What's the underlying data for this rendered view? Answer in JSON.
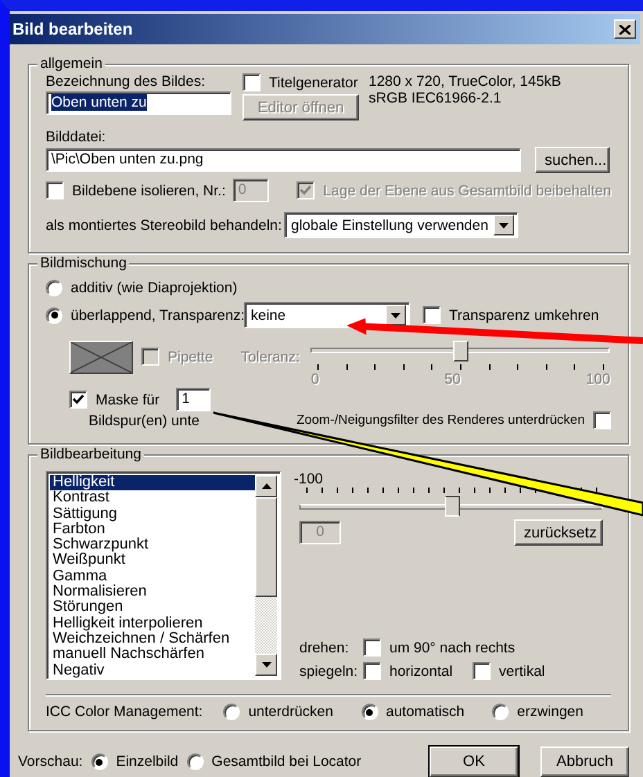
{
  "window": {
    "title": "Bild bearbeiten"
  },
  "allgemein": {
    "legend": "allgemein",
    "name_label": "Bezeichnung des Bildes:",
    "name_value": "Oben unten zu",
    "title_generator": {
      "label": "Titelgenerator",
      "checked": false
    },
    "editor_button": {
      "label": "Editor öffnen",
      "disabled": true
    },
    "image_info": [
      "1280 x 720, TrueColor, 145kB",
      "sRGB IEC61966-2.1"
    ],
    "file_label": "Bilddatei:",
    "file_value": "\\Pic\\Oben unten zu.png",
    "browse_button": "suchen...",
    "isolate": {
      "label": "Bildebene isolieren, Nr.:",
      "checked": false
    },
    "layer_number": {
      "value": "0",
      "disabled": true
    },
    "keep_position": {
      "label": "Lage der Ebene aus Gesamtbild beibehalten",
      "checked": true,
      "disabled": true
    },
    "stereo_label": "als montiertes Stereobild behandeln:",
    "stereo_value": "globale Einstellung verwenden"
  },
  "bildmischung": {
    "legend": "Bildmischung",
    "modes": [
      {
        "label": "additiv (wie Diaprojektion)",
        "selected": false
      },
      {
        "label": "überlappend, Transparenz:",
        "selected": true
      }
    ],
    "transparency": "keine",
    "invert": {
      "label": "Transparenz umkehren",
      "checked": false
    },
    "pipette": {
      "label": "Pipette",
      "checked": false,
      "disabled": true
    },
    "tolerance": {
      "label": "Toleranz:",
      "disabled": true,
      "level": 0.5,
      "ticks": [
        "0",
        "50",
        "100"
      ]
    },
    "mask": {
      "label": "Maske für",
      "checked": true,
      "value": "1"
    },
    "mask_suffix": "Bildspur(en) unte",
    "zoom_filter": {
      "label": "Zoom-/Neigungsfilter des Renderes unterdrücken",
      "checked": false
    }
  },
  "bildbearbeitung": {
    "legend": "Bildbearbeitung",
    "adjustments": [
      {
        "label": "Helligkeit",
        "selected": true
      },
      {
        "label": "Kontrast",
        "selected": false
      },
      {
        "label": "Sättigung",
        "selected": false
      },
      {
        "label": "Farbton",
        "selected": false
      },
      {
        "label": "Schwarzpunkt",
        "selected": false
      },
      {
        "label": "Weißpunkt",
        "selected": false
      },
      {
        "label": "Gamma",
        "selected": false
      },
      {
        "label": "Normalisieren",
        "selected": false
      },
      {
        "label": "Störungen",
        "selected": false
      },
      {
        "label": "Helligkeit interpolieren",
        "selected": false
      },
      {
        "label": "Weichzeichnen / Schärfen",
        "selected": false
      },
      {
        "label": "manuell Nachschärfen",
        "selected": false
      },
      {
        "label": "Negativ",
        "selected": false
      }
    ],
    "slider": {
      "min_label": "-100",
      "level": 0.5
    },
    "value": "0",
    "reset_button": "zurücksetz",
    "rotate_label": "drehen:",
    "rotate": {
      "label": "um 90° nach rechts",
      "checked": false
    },
    "mirror_label": "spiegeln:",
    "mirror": [
      {
        "label": "horizontal",
        "checked": false
      },
      {
        "label": "vertikal",
        "checked": false
      }
    ],
    "icc_label": "ICC Color Management:",
    "icc_options": [
      {
        "label": "unterdrücken",
        "selected": false
      },
      {
        "label": "automatisch",
        "selected": true
      },
      {
        "label": "erzwingen",
        "selected": false
      }
    ]
  },
  "footer": {
    "preview_label": "Vorschau:",
    "preview_options": [
      {
        "label": "Einzelbild",
        "selected": true
      },
      {
        "label": "Gesamtbild bei Locator",
        "selected": false
      }
    ],
    "buttons": [
      {
        "label": "OK",
        "default": true
      },
      {
        "label": "Abbruch",
        "default": false
      }
    ]
  },
  "annotations": [
    {
      "kind": "arrow",
      "color": "#ff0000"
    },
    {
      "kind": "callout",
      "color": "#ffff00"
    }
  ]
}
